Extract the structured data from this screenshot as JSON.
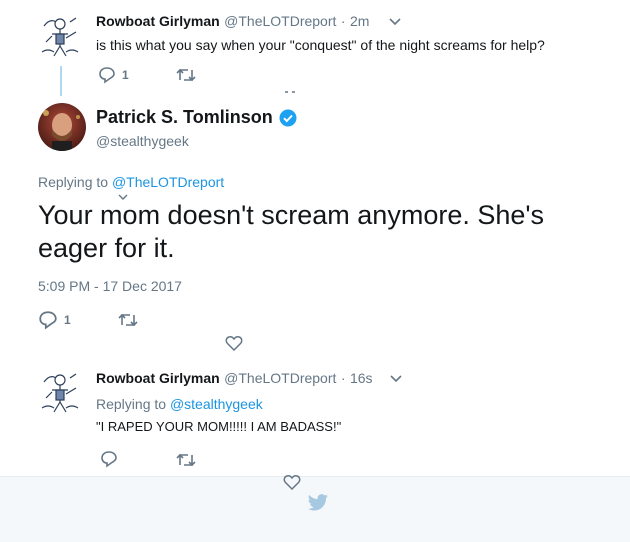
{
  "tweet1": {
    "display_name": "Rowboat Girlyman",
    "handle": "@TheLOTDreport",
    "separator": "·",
    "time": "2m",
    "text": "is this what you say when your \"conquest\" of the night screams for help?",
    "reply_count": "1"
  },
  "main_tweet": {
    "display_name": "Patrick S. Tomlinson",
    "handle": "@stealthygeek",
    "replying_prefix": "Replying to",
    "replying_handle": "@TheLOTDreport",
    "text": "Your mom doesn't scream anymore. She's eager for it.",
    "timestamp": "5:09 PM - 17 Dec 2017",
    "reply_count": "1"
  },
  "tweet3": {
    "display_name": "Rowboat Girlyman",
    "handle": "@TheLOTDreport",
    "separator": "·",
    "time": "16s",
    "replying_prefix": "Replying to",
    "replying_handle": "@stealthygeek",
    "text": "\"I RAPED YOUR MOM!!!!! I AM BADASS!\""
  },
  "colors": {
    "link": "#1b95e0",
    "muted": "#657786",
    "verified": "#1da1f2",
    "footer_bg": "#f5f8fa"
  },
  "icons": [
    "reply-icon",
    "retweet-icon",
    "like-icon",
    "chevron-down-icon",
    "verified-badge-icon",
    "twitter-bird-icon"
  ]
}
